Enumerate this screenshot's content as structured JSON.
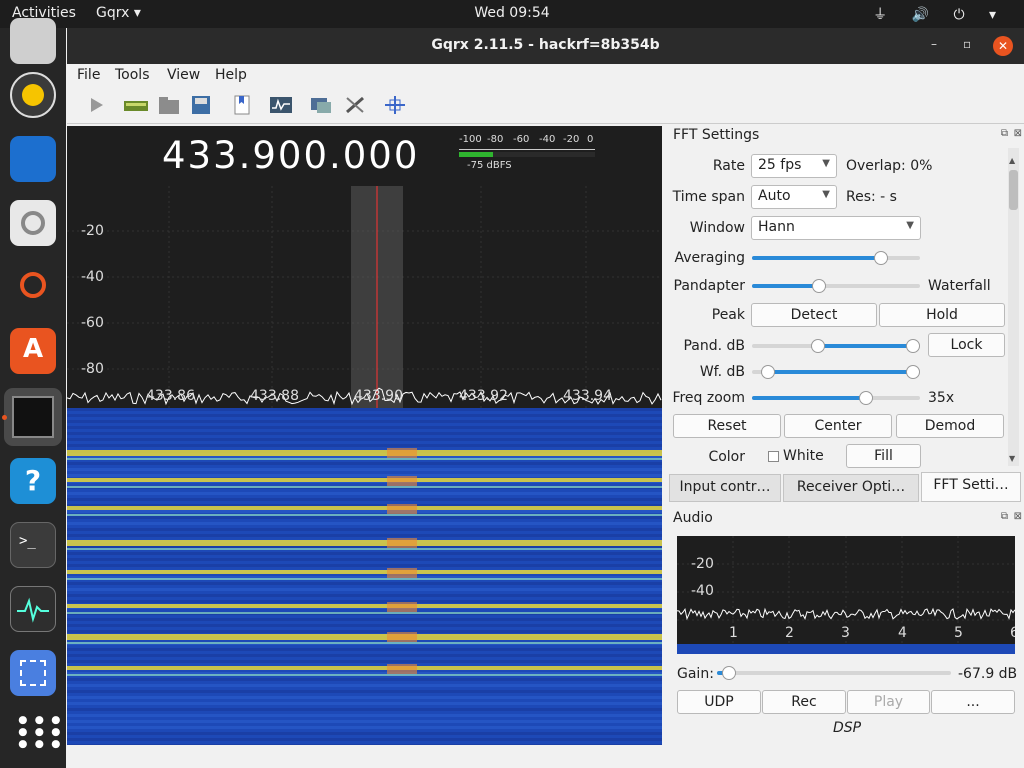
{
  "topbar": {
    "activities": "Activities",
    "app_name": "Gqrx ▾",
    "clock": "Wed 09:54",
    "tray": "⏚ 🔊 ⏻ ▾"
  },
  "window": {
    "title": "Gqrx 2.11.5 - hackrf=8b354b",
    "minimize": "–",
    "maximize": "▫",
    "close": "✕"
  },
  "menu": [
    "File",
    "Tools",
    "View",
    "Help"
  ],
  "plot": {
    "frequency": "433.900.000",
    "smeter_scale": [
      "-100",
      "-80",
      "-60",
      "-40",
      "-20",
      "0"
    ],
    "smeter_value": "-75 dBFS",
    "smeter_level": 0.25,
    "y_ticks": [
      "-20",
      "-40",
      "-60",
      "-80"
    ],
    "x_ticks": [
      "433.86",
      "433.88",
      "433.90",
      "433.92",
      "433.94"
    ]
  },
  "fft": {
    "title": "FFT Settings",
    "rate_label": "Rate",
    "rate_value": "25 fps",
    "overlap": "Overlap: 0%",
    "timespan_label": "Time span",
    "timespan_value": "Auto",
    "res": "Res: - s",
    "window_label": "Window",
    "window_value": "Hann",
    "averaging_label": "Averaging",
    "averaging_level": 0.77,
    "pandapter_label": "Pandapter",
    "waterfall_label": "Waterfall",
    "split_level": 0.4,
    "peak_label": "Peak",
    "detect": "Detect",
    "hold": "Hold",
    "pand_db_label": "Pand. dB",
    "lock": "Lock",
    "wf_db_label": "Wf. dB",
    "freq_zoom_label": "Freq zoom",
    "freq_zoom_value": "35x",
    "freq_zoom_level": 0.68,
    "reset": "Reset",
    "center": "Center",
    "demod": "Demod",
    "color_label": "Color",
    "white_label": "White",
    "fill": "Fill"
  },
  "tabs": [
    "Input contr…",
    "Receiver Opti…",
    "FFT Setti…"
  ],
  "audio": {
    "title": "Audio",
    "y_ticks": [
      "-20",
      "-40"
    ],
    "x_ticks": [
      "1",
      "2",
      "3",
      "4",
      "5",
      "6"
    ],
    "gain_label": "Gain:",
    "gain_value": "-67.9 dB",
    "gain_level": 0.05,
    "udp": "UDP",
    "rec": "Rec",
    "play": "Play",
    "more": "...",
    "dsp": "DSP"
  },
  "colors": {
    "accent": "#2a8ad8",
    "close": "#e95420",
    "waterfall_bg": "#1d49b7",
    "marker": "#ff3333"
  }
}
